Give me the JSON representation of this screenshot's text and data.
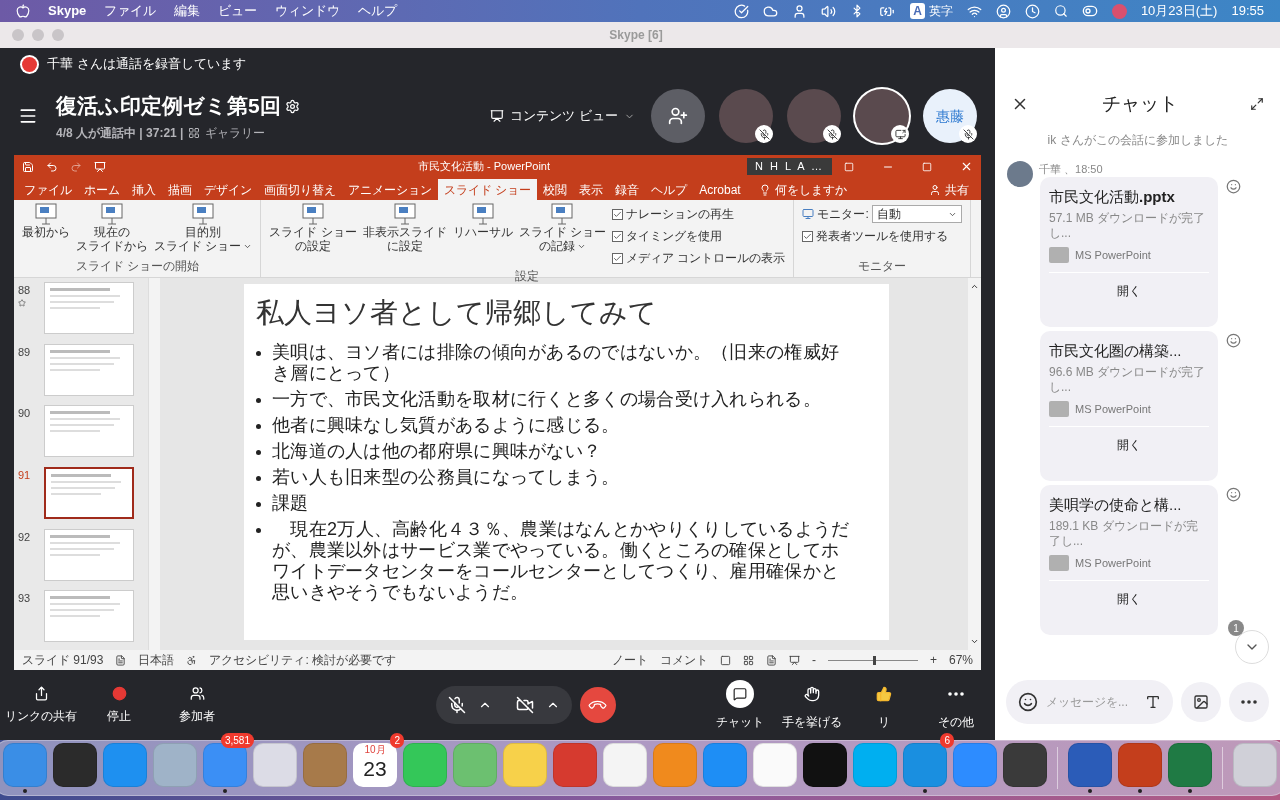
{
  "menubar": {
    "app": "Skype",
    "menus": [
      "ファイル",
      "編集",
      "ビュー",
      "ウィンドウ",
      "ヘルプ"
    ],
    "input_mode": "A",
    "input_label": "英字",
    "date": "10月23日(土)",
    "time": "19:55"
  },
  "window": {
    "title": "Skype [6]"
  },
  "recording_banner": {
    "text": "千華 さんは通話を録音しています"
  },
  "call": {
    "title": "復活ふ印定例ゼミ第5回",
    "status": "4/8 人が通話中 | 37:21 |",
    "layout": "ギャラリー",
    "view_button": "コンテンツ ビュー"
  },
  "participants": [
    {
      "kind": "add",
      "speaking": false
    },
    {
      "kind": "photo",
      "muted": true,
      "sharing": false,
      "speaking": false
    },
    {
      "kind": "photo",
      "muted": true,
      "sharing": false,
      "speaking": false
    },
    {
      "kind": "photo",
      "muted": false,
      "sharing": true,
      "speaking": true
    },
    {
      "kind": "initials",
      "initials": "惠藤",
      "muted": true,
      "sharing": false,
      "speaking": false
    }
  ],
  "powerpoint": {
    "title": "市民文化活動 - PowerPoint",
    "account": "N H L A …",
    "tell_me": "何をしますか",
    "share": "共有",
    "tabs": [
      {
        "label": "ファイル",
        "selected": false
      },
      {
        "label": "ホーム",
        "selected": false
      },
      {
        "label": "挿入",
        "selected": false
      },
      {
        "label": "描画",
        "selected": false
      },
      {
        "label": "デザイン",
        "selected": false
      },
      {
        "label": "画面切り替え",
        "selected": false
      },
      {
        "label": "アニメーション",
        "selected": false
      },
      {
        "label": "スライド ショー",
        "selected": true
      },
      {
        "label": "校閲",
        "selected": false
      },
      {
        "label": "表示",
        "selected": false
      },
      {
        "label": "録音",
        "selected": false
      },
      {
        "label": "ヘルプ",
        "selected": false
      },
      {
        "label": "Acrobat",
        "selected": false
      }
    ],
    "ribbon_groups": [
      {
        "label": "スライド ショーの開始",
        "buttons": [
          {
            "lines": [
              "最初から"
            ],
            "dropdown": false
          },
          {
            "lines": [
              "現在の",
              "スライドから"
            ],
            "dropdown": false
          },
          {
            "lines": [
              "目的別",
              "スライド ショー"
            ],
            "dropdown": true
          }
        ]
      },
      {
        "label": "設定",
        "buttons": [
          {
            "lines": [
              "スライド ショー",
              "の設定"
            ],
            "dropdown": false
          },
          {
            "lines": [
              "非表示スライド",
              "に設定"
            ],
            "dropdown": false
          },
          {
            "lines": [
              "リハーサル"
            ],
            "dropdown": false
          },
          {
            "lines": [
              "スライド ショー",
              "の記録"
            ],
            "dropdown": true
          }
        ],
        "options": [
          {
            "kind": "checkbox",
            "label": "ナレーションの再生",
            "checked": true
          },
          {
            "kind": "checkbox",
            "label": "タイミングを使用",
            "checked": true
          },
          {
            "kind": "checkbox",
            "label": "メディア コントロールの表示",
            "checked": true
          }
        ]
      },
      {
        "label": "モニター",
        "options": [
          {
            "kind": "select",
            "label": "モニター:",
            "value": "自動"
          },
          {
            "kind": "checkbox",
            "label": "発表者ツールを使用する",
            "checked": true
          }
        ]
      }
    ]
  },
  "slides": [
    {
      "number": "88",
      "selected": false,
      "animated": true
    },
    {
      "number": "89",
      "selected": false,
      "animated": false
    },
    {
      "number": "90",
      "selected": false,
      "animated": false
    },
    {
      "number": "91",
      "selected": true,
      "animated": false
    },
    {
      "number": "92",
      "selected": false,
      "animated": false
    },
    {
      "number": "93",
      "selected": false,
      "animated": false
    }
  ],
  "slide": {
    "title": "私人ヨソ者として帰郷してみて",
    "bullets": [
      "美唄は、ヨソ者には排除の傾向があるのではないか。（旧来の権威好き層にとって）",
      "一方で、市民文化活動を取材に行くと多くの場合受け入れられる。",
      "他者に興味なし気質があるように感じる。",
      "北海道の人は他の都府県に興味がない？",
      "若い人も旧来型の公務員になってしまう。",
      "課題",
      "　現在2万人、高齢化４３％、農業はなんとかやりくりしているようだが、農業以外はサービス業でやっている。働くところの確保としてホワイトデータセンターをコールセンターとしてつくり、雇用確保かと思いきやそうでもないようだ。"
    ]
  },
  "status_bar": {
    "slide": "スライド 91/93",
    "language": "日本語",
    "accessibility": "アクセシビリティ: 検討が必要です",
    "notes": "ノート",
    "comments": "コメント",
    "zoom_minus": "-",
    "zoom_plus": "+",
    "zoom": "67%",
    "level": 0.5
  },
  "call_controls": {
    "left": [
      {
        "kind": "share",
        "label": "リンクの共有"
      },
      {
        "kind": "record",
        "label": "停止"
      },
      {
        "kind": "people",
        "label": "参加者"
      }
    ],
    "mic_on": false,
    "camera_on": false,
    "right": [
      {
        "kind": "chat",
        "label": "チャット"
      },
      {
        "kind": "hand",
        "label": "手を挙げる"
      },
      {
        "kind": "react",
        "label": "リ"
      },
      {
        "kind": "more",
        "label": "その他"
      }
    ]
  },
  "chat": {
    "title": "チャット",
    "system_message": "ik さんがこの会話に参加しました",
    "sender": "千華 、18:50",
    "files": [
      {
        "title": "市民文化活動**.pptx**",
        "meta": "57.1 MB ダウンロードが完了し...",
        "app": "MS PowerPoint",
        "action": "開く"
      },
      {
        "title": "市民文化圏の構築...",
        "meta": "96.6 MB ダウンロードが完了し...",
        "app": "MS PowerPoint",
        "action": "開く"
      },
      {
        "title": "美唄学の使命と構...",
        "meta": "189.1 KB ダウンロードが完了し...",
        "app": "MS PowerPoint",
        "action": "開く"
      }
    ],
    "unread": "1",
    "placeholder": "メッセージを..."
  },
  "dock": [
    {
      "kind": "app",
      "color": "#3a8ee6",
      "running": true
    },
    {
      "kind": "app",
      "color": "#2b2b2b",
      "running": false
    },
    {
      "kind": "app",
      "color": "#1e90f0",
      "running": false
    },
    {
      "kind": "app",
      "color": "#9fb3c8",
      "running": false
    },
    {
      "kind": "app",
      "color": "#3b8ff5",
      "running": true,
      "badge": "3,581"
    },
    {
      "kind": "app",
      "color": "#dcdce6",
      "running": false
    },
    {
      "kind": "app",
      "color": "#a77a4a",
      "running": false
    },
    {
      "kind": "calendar",
      "color": "#ffffff",
      "running": false,
      "month": "10月",
      "day": "23",
      "badge": "2"
    },
    {
      "kind": "app",
      "color": "#34c759",
      "running": false
    },
    {
      "kind": "app",
      "color": "#6cc070",
      "running": false
    },
    {
      "kind": "app",
      "color": "#f7d14a",
      "running": false
    },
    {
      "kind": "app",
      "color": "#d63a2f",
      "running": false
    },
    {
      "kind": "app",
      "color": "#f4f4f4",
      "running": false
    },
    {
      "kind": "app",
      "color": "#f08a1d",
      "running": false
    },
    {
      "kind": "app",
      "color": "#1e8ef5",
      "running": false
    },
    {
      "kind": "app",
      "color": "#fafafa",
      "running": false
    },
    {
      "kind": "app",
      "color": "#111111",
      "running": false
    },
    {
      "kind": "app",
      "color": "#00aff0",
      "running": false
    },
    {
      "kind": "app",
      "color": "#1a8fe0",
      "running": true,
      "badge": "6"
    },
    {
      "kind": "app",
      "color": "#2d8cff",
      "running": false
    },
    {
      "kind": "app",
      "color": "#3a3a3a",
      "running": false
    },
    {
      "kind": "separator"
    },
    {
      "kind": "app",
      "color": "#2b5cb8",
      "running": true
    },
    {
      "kind": "app",
      "color": "#c43e1c",
      "running": true
    },
    {
      "kind": "app",
      "color": "#1f7a44",
      "running": true
    },
    {
      "kind": "separator"
    },
    {
      "kind": "app",
      "color": "#d0d0d8",
      "running": false
    }
  ]
}
